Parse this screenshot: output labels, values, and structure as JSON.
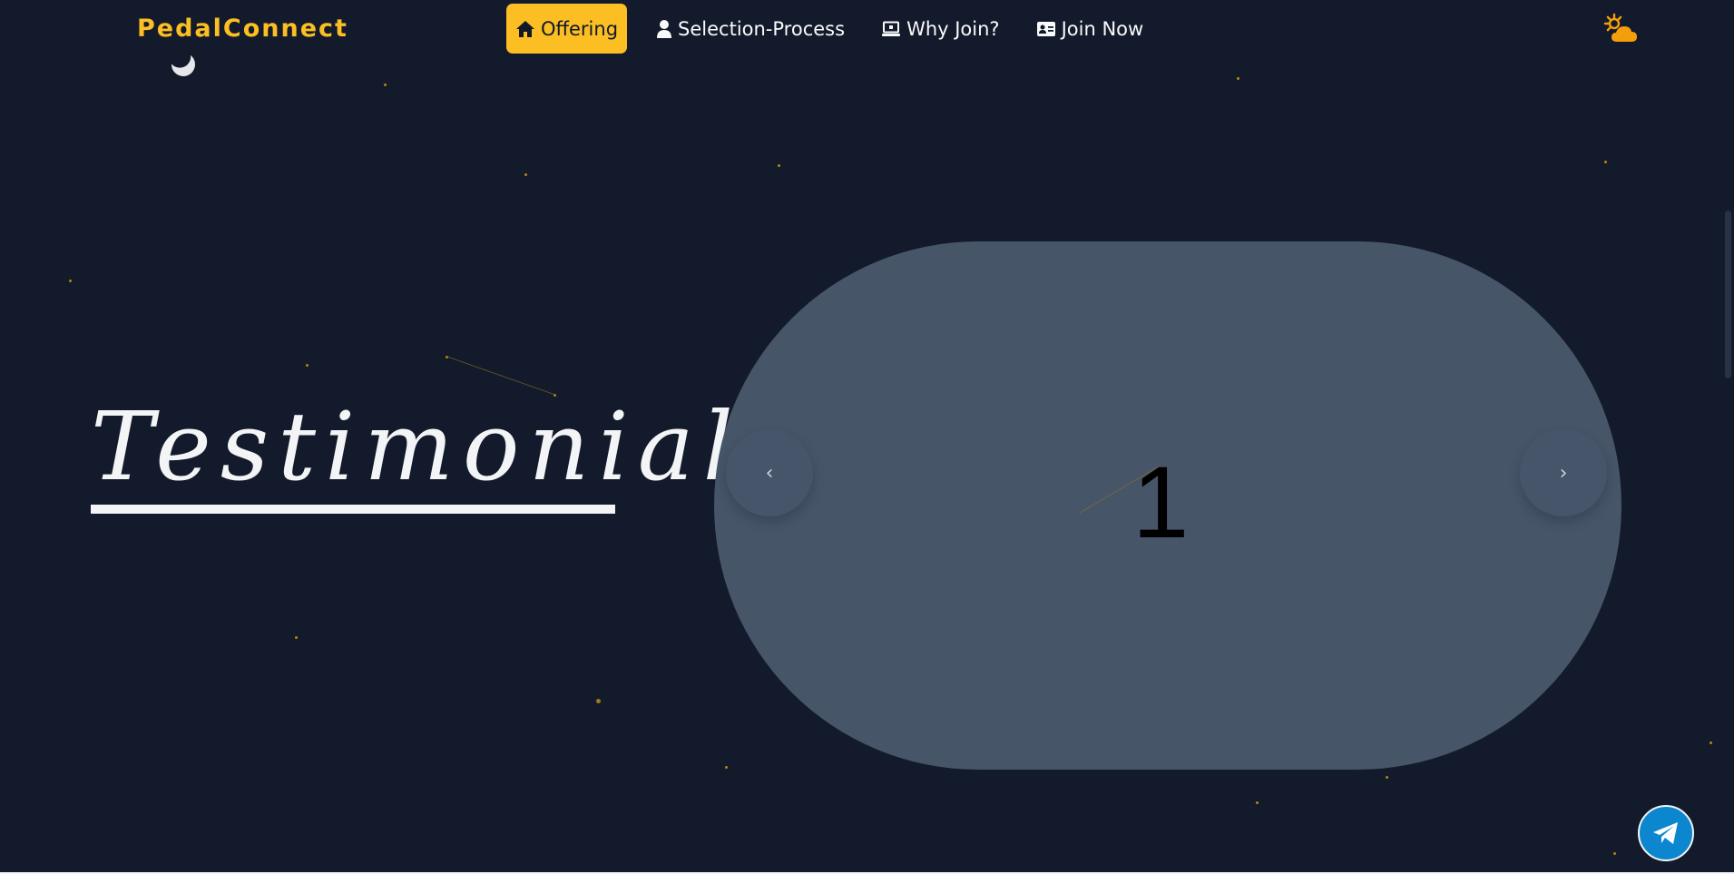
{
  "header": {
    "brand": "PedalConnect",
    "nav": [
      {
        "label": "Offering",
        "icon": "home-icon",
        "active": true
      },
      {
        "label": "Selection-Process",
        "icon": "user-icon",
        "active": false
      },
      {
        "label": "Why Join?",
        "icon": "laptop-icon",
        "active": false
      },
      {
        "label": "Join Now",
        "icon": "id-card-icon",
        "active": false
      }
    ],
    "theme_toggle_icon": "sun-cloud-icon"
  },
  "hero": {
    "title": "Testimonials"
  },
  "carousel": {
    "current_slide": "1",
    "prev_label": "‹",
    "next_label": "›"
  },
  "fab": {
    "icon": "telegram-icon"
  },
  "colors": {
    "background": "#131a2b",
    "accent": "#fbbf24",
    "carousel": "#475569",
    "telegram": "#0c87cf"
  }
}
